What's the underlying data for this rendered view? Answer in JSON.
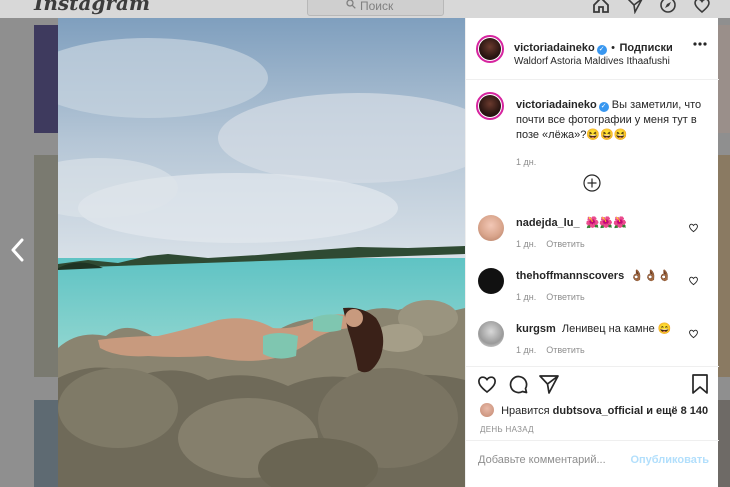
{
  "app": {
    "logo_text": "Instagram"
  },
  "search": {
    "placeholder": "Поиск"
  },
  "nav": {
    "icons": [
      "home-icon",
      "direct-icon",
      "explore-icon",
      "activity-icon"
    ]
  },
  "post": {
    "username": "victoriadaineko",
    "follow_separator": "•",
    "follow_label": "Подписки",
    "location": "Waldorf Astoria Maldives Ithaafushi",
    "caption": "Вы заметили, что почти все фотографии у меня тут в позе «лёжа»?😆😆😆",
    "caption_time": "1 дн.",
    "likes_prefix": "Нравится",
    "likes_user": "dubtsova_official",
    "likes_suffix": "и ещё 8 140",
    "posted_ago": "ДЕНЬ НАЗАД"
  },
  "comments": [
    {
      "user": "nadejda_lu_",
      "text": "🌺🌺🌺",
      "time": "1 дн.",
      "reply": "Ответить"
    },
    {
      "user": "thehoffmannscovers",
      "text": "👌🏾👌🏾👌🏾",
      "time": "1 дн.",
      "reply": "Ответить"
    },
    {
      "user": "kurgsm",
      "text": "Ленивец на камне 😄",
      "time": "1 дн.",
      "reply": "Ответить"
    }
  ],
  "composer": {
    "placeholder": "Добавьте комментарий...",
    "publish_label": "Опубликовать"
  },
  "colors": {
    "verified": "#3897f0",
    "publish_disabled": "#b2dffc",
    "overlay": "#8f8f8f"
  }
}
